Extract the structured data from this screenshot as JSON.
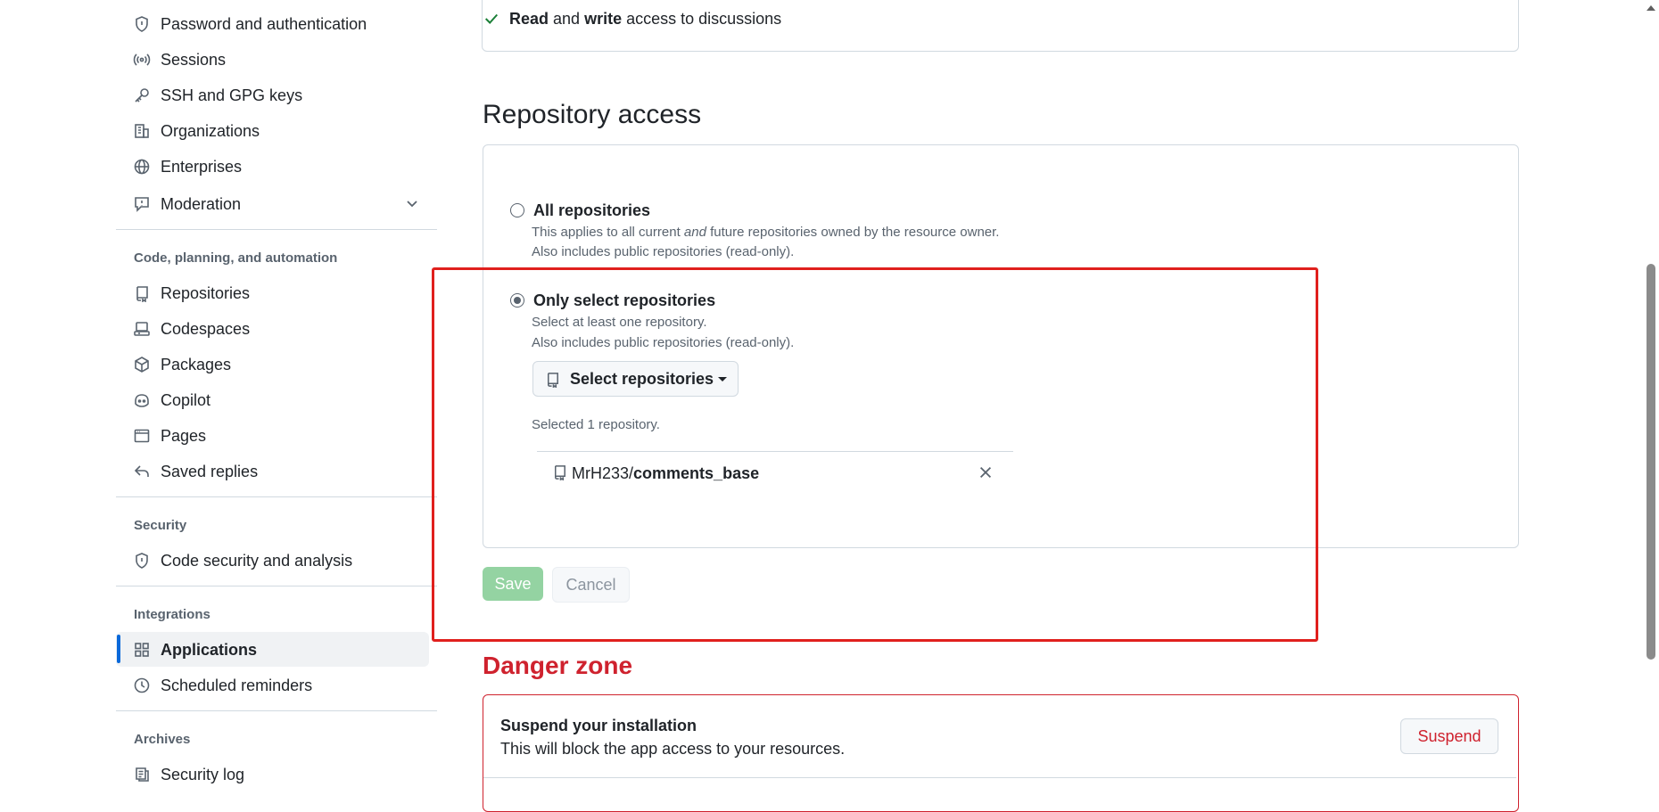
{
  "sidebar": {
    "items_top": [
      {
        "label": "Password and authentication",
        "icon": "shield-icon"
      },
      {
        "label": "Sessions",
        "icon": "broadcast-icon"
      },
      {
        "label": "SSH and GPG keys",
        "icon": "key-icon"
      },
      {
        "label": "Organizations",
        "icon": "organization-icon"
      },
      {
        "label": "Enterprises",
        "icon": "globe-icon"
      },
      {
        "label": "Moderation",
        "icon": "report-icon"
      }
    ],
    "sections": [
      {
        "heading": "Code, planning, and automation"
      },
      {
        "heading": "Security"
      },
      {
        "heading": "Integrations"
      },
      {
        "heading": "Archives"
      }
    ],
    "code_items": [
      {
        "label": "Repositories",
        "icon": "repo-icon"
      },
      {
        "label": "Codespaces",
        "icon": "codespaces-icon"
      },
      {
        "label": "Packages",
        "icon": "package-icon"
      },
      {
        "label": "Copilot",
        "icon": "copilot-icon"
      },
      {
        "label": "Pages",
        "icon": "browser-icon"
      },
      {
        "label": "Saved replies",
        "icon": "reply-icon"
      }
    ],
    "security_items": [
      {
        "label": "Code security and analysis",
        "icon": "shield-icon"
      }
    ],
    "integration_items": [
      {
        "label": "Applications",
        "icon": "apps-icon"
      },
      {
        "label": "Scheduled reminders",
        "icon": "clock-icon"
      }
    ],
    "archive_items": [
      {
        "label": "Security log",
        "icon": "log-icon"
      }
    ]
  },
  "permissions": {
    "line_read": "Read",
    "line_and": " and ",
    "line_write": "write",
    "line_rest": " access to discussions"
  },
  "repo_access": {
    "title": "Repository access",
    "all": {
      "title": "All repositories",
      "desc1_a": "This applies to all current ",
      "desc1_em": "and",
      "desc1_b": " future repositories owned by the resource owner.",
      "desc2": "Also includes public repositories (read-only)."
    },
    "select": {
      "title": "Only select repositories",
      "desc1": "Select at least one repository.",
      "desc2": "Also includes public repositories (read-only).",
      "button_label": "Select repositories",
      "selected_count": "Selected 1 repository.",
      "repo_owner": "MrH233/",
      "repo_name": "comments_base"
    },
    "save_label": "Save",
    "cancel_label": "Cancel"
  },
  "danger": {
    "title": "Danger zone",
    "suspend_title": "Suspend your installation",
    "suspend_desc": "This will block the app access to your resources.",
    "suspend_button": "Suspend"
  },
  "colors": {
    "accent": "#0969da",
    "danger": "#cf222e",
    "save_disabled": "#94d3a2",
    "highlight_frame": "#e0201d"
  }
}
